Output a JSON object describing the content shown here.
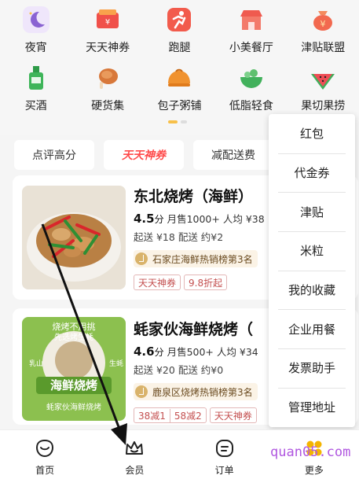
{
  "categories": [
    {
      "label": "夜宵",
      "icon": "moon-icon",
      "color": "#8a63d2"
    },
    {
      "label": "天天神券",
      "icon": "coupon-icon",
      "color": "#f0504a"
    },
    {
      "label": "跑腿",
      "icon": "runner-icon",
      "color": "#f25b4c"
    },
    {
      "label": "小美餐厅",
      "icon": "shop-icon",
      "color": "#f37a6a"
    },
    {
      "label": "津贴联盟",
      "icon": "money-bag-icon",
      "color": "#f2694f"
    },
    {
      "label": "买酒",
      "icon": "bottle-icon",
      "color": "#3fb55a"
    },
    {
      "label": "硬货集",
      "icon": "drumstick-icon",
      "color": "#d8783a"
    },
    {
      "label": "包子粥铺",
      "icon": "bun-icon",
      "color": "#f0922f"
    },
    {
      "label": "低脂轻食",
      "icon": "salad-icon",
      "color": "#42b15c"
    },
    {
      "label": "果切果捞",
      "icon": "watermelon-icon",
      "color": "#ef4d55"
    }
  ],
  "filters": [
    "点评高分",
    "天天神券",
    "减配送费"
  ],
  "stores": [
    {
      "name": "东北烧烤（海鲜）",
      "score": "4.5",
      "score_unit": "分",
      "sales": "月售1000+",
      "avg": "人均 ¥38",
      "min_order": "起送 ¥18",
      "delivery": "配送 约¥2",
      "rank": "石家庄海鲜热销榜第3名",
      "tags": [
        "天天神券",
        "9.8折起"
      ]
    },
    {
      "name": "蚝家伙海鲜烧烤（",
      "score": "4.6",
      "score_unit": "分",
      "sales": "月售500+",
      "avg": "人均 ¥34",
      "min_order": "起送 ¥20",
      "delivery": "配送 约¥0",
      "rank": "鹿泉区烧烤热销榜第3名",
      "tag_group": [
        "38减1",
        "58减2"
      ],
      "tags": [
        "天天神券"
      ],
      "banner_text": [
        "烧烤不用挑",
        "先选烤生蚝",
        "海鲜烧烤",
        "蚝家伙海鲜烧烤",
        "乳山",
        "生蚝"
      ]
    }
  ],
  "menu": [
    "红包",
    "代金券",
    "津贴",
    "米粒",
    "我的收藏",
    "企业用餐",
    "发票助手",
    "管理地址"
  ],
  "nav": [
    {
      "label": "首页",
      "icon": "home-icon"
    },
    {
      "label": "会员",
      "icon": "crown-icon"
    },
    {
      "label": "订单",
      "icon": "order-icon"
    },
    {
      "label": "更多",
      "icon": "grid-icon"
    }
  ],
  "watermark": "quan05.com"
}
